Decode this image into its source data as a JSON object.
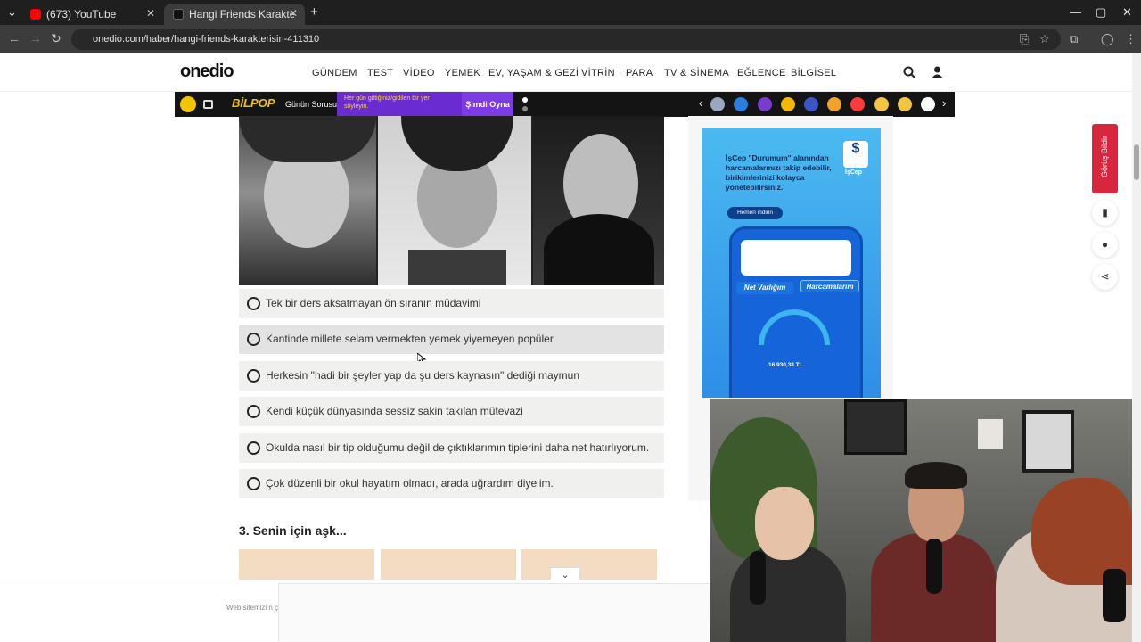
{
  "browser": {
    "tabs": [
      {
        "title": "(673) YouTube",
        "favicon_color": "#ff0000"
      },
      {
        "title": "Hangi Friends Karakterisin? - O",
        "favicon_color": "#111111"
      }
    ],
    "url": "onedio.com/haber/hangi-friends-karakterisin-411310",
    "icons": {
      "back": "←",
      "forward": "→",
      "reload": "↻",
      "new_tab": "+",
      "close": "✕",
      "minimize": "—",
      "maximize": "▢",
      "star": "☆",
      "menu": "⋮",
      "tab_search": "⌄",
      "profile": "◯",
      "extensions": "⧉",
      "cast": "⎘"
    }
  },
  "site": {
    "logo": "onedio",
    "nav": [
      "GÜNDEM",
      "TEST",
      "VİDEO",
      "YEMEK",
      "EV, YAŞAM & GEZİ",
      "VİTRİN",
      "PARA",
      "TV & SİNEMA",
      "EĞLENCE",
      "BİLGİSEL"
    ],
    "subbar": {
      "brand": "BİLPOP",
      "daily_question": "Günün Sorusu",
      "promo": "Her gün gittiğiniz/gidilen bir yer söyleyin.",
      "play_label": "Şimdi Oyna",
      "reaction_colors": [
        "#9aa7c2",
        "#2b7de0",
        "#7a3bd0",
        "#f2b705",
        "#3a55c6",
        "#f0a22b",
        "#ff3b3b",
        "#f4c542",
        "#f4c542",
        "#ffffff"
      ]
    }
  },
  "question": {
    "options": [
      "Tek bir ders aksatmayan ön sıranın müdavimi",
      "Kantinde millete selam vermekten yemek yiyemeyen popüler",
      "Herkesin \"hadi bir şeyler yap da şu ders kaynasın\" dediği maymun",
      "Kendi küçük dünyasında sessiz sakin takılan mütevazi",
      "Okulda nasıl bir tip olduğumu değil de çıktıklarımın tiplerini daha net hatırlıyorum.",
      "Çok düzenli bir okul hayatım olmadı, arada uğrardım diyelim."
    ],
    "next_title": "3. Senin için aşk..."
  },
  "ad": {
    "headline": "İşCep \"Durumum\" alanından harcamalarınızı takip edebilir, birikimlerinizi kolayca yönetebilirsiniz.",
    "cta": "Hemen indirin",
    "brand": "İşCep",
    "pills": [
      "Net Varlığım",
      "Harcamalarım"
    ],
    "amount": "16.930,38 TL"
  },
  "sidebar": {
    "feedback": "Görüş Bildir",
    "buttons": [
      "bookmark-icon",
      "comments-icon",
      "share-icon"
    ]
  },
  "cookie": {
    "text": "Web sitemizi n çerezler kullanı"
  }
}
